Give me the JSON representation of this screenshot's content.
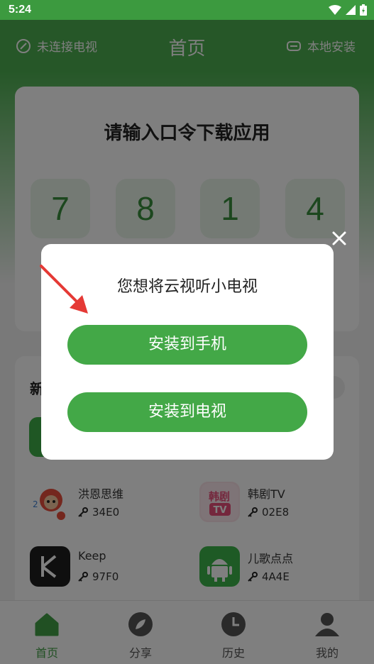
{
  "status_bar": {
    "time": "5:24"
  },
  "header": {
    "left_label": "未连接电视",
    "title": "首页",
    "right_label": "本地安装"
  },
  "code_card": {
    "title": "请输入口令下载应用",
    "digits": [
      "7",
      "8",
      "1",
      "4"
    ]
  },
  "apps_section": {
    "title": "新",
    "apps": [
      {
        "name": "洪恩思维",
        "code": "34E0",
        "icon": "hongen-monkey-icon"
      },
      {
        "name": "韩剧TV",
        "code": "02E8",
        "icon": "hanju-tv-icon"
      },
      {
        "name": "Keep",
        "code": "97F0",
        "icon": "keep-icon"
      },
      {
        "name": "儿歌点点",
        "code": "4A4E",
        "icon": "android-icon"
      }
    ]
  },
  "tabs": [
    {
      "label": "首页",
      "icon": "home-icon",
      "active": true
    },
    {
      "label": "分享",
      "icon": "compass-icon",
      "active": false
    },
    {
      "label": "历史",
      "icon": "clock-icon",
      "active": false
    },
    {
      "label": "我的",
      "icon": "user-icon",
      "active": false
    }
  ],
  "dialog": {
    "question": "您想将云视听小电视",
    "install_phone_label": "安装到手机",
    "install_tv_label": "安装到电视"
  },
  "colors": {
    "primary_green": "#4caf50",
    "button_green": "#43a847",
    "arrow_red": "#e53935"
  }
}
